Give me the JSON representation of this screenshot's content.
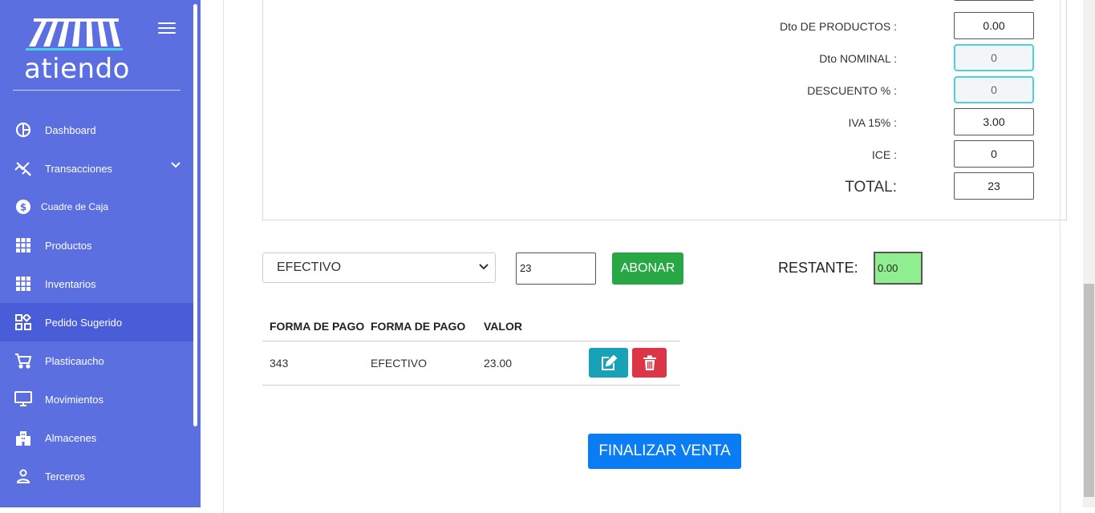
{
  "brand": {
    "logo_text": "atiendo"
  },
  "sidebar": {
    "items": [
      {
        "label": "Dashboard",
        "icon": "pie-chart-icon"
      },
      {
        "label": "Transacciones",
        "icon": "transactions-icon"
      },
      {
        "label": "Cuadre de Caja",
        "icon": "dollar-circle-icon"
      },
      {
        "label": "Productos",
        "icon": "grid-icon"
      },
      {
        "label": "Inventarios",
        "icon": "grid-icon"
      },
      {
        "label": "Pedido Sugerido",
        "icon": "widgets-icon"
      },
      {
        "label": "Plasticaucho",
        "icon": "cart-icon"
      },
      {
        "label": "Movimientos",
        "icon": "monitor-icon"
      },
      {
        "label": "Almacenes",
        "icon": "building-icon"
      },
      {
        "label": "Terceros",
        "icon": "person-icon"
      }
    ],
    "active": "Pedido Sugerido"
  },
  "totals": {
    "dto_productos": {
      "label": "Dto DE PRODUCTOS :",
      "value": "0.00"
    },
    "dto_nominal": {
      "label": "Dto NOMINAL :",
      "value": "0"
    },
    "descuento": {
      "label": "DESCUENTO % :",
      "value": "0"
    },
    "iva": {
      "label": "IVA 15% :",
      "value": "3.00"
    },
    "ice": {
      "label": "ICE :",
      "value": "0"
    },
    "total": {
      "label": "TOTAL:",
      "value": "23"
    }
  },
  "payment": {
    "method_selected": "EFECTIVO",
    "amount": "23",
    "abonar_label": "ABONAR",
    "restante_label": "RESTANTE:",
    "restante_value": "0.00"
  },
  "payments_table": {
    "headers": [
      "FORMA DE PAGO",
      "FORMA DE PAGO",
      "VALOR"
    ],
    "rows": [
      {
        "id": "343",
        "method": "EFECTIVO",
        "value": "23.00"
      }
    ]
  },
  "finalizar_label": "FINALIZAR VENTA",
  "colors": {
    "sidebar": "#5b6fe0",
    "sidebar_active": "#4a5dd8",
    "abonar": "#28a745",
    "finalizar": "#0a7df5",
    "edit": "#17a2b8",
    "delete": "#dc3545",
    "restante_bg": "#90ee90"
  }
}
